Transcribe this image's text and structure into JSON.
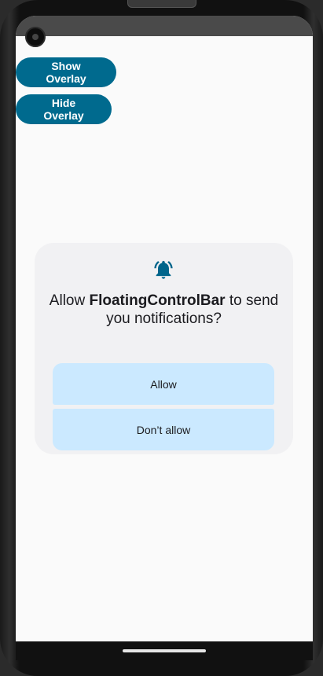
{
  "app": {
    "buttons": {
      "show_overlay": "Show Overlay",
      "hide_overlay": "Hide Overlay"
    }
  },
  "permission_dialog": {
    "icon": "notification-bell-icon",
    "title_prefix": "Allow ",
    "app_name": "FloatingControlBar",
    "title_suffix": " to send you notifications?",
    "allow_label": "Allow",
    "deny_label": "Don’t allow"
  },
  "colors": {
    "primary_button": "#006a8e",
    "dialog_background": "#f1f1f3",
    "permission_button": "#cbe9ff",
    "icon_accent": "#00658b"
  }
}
